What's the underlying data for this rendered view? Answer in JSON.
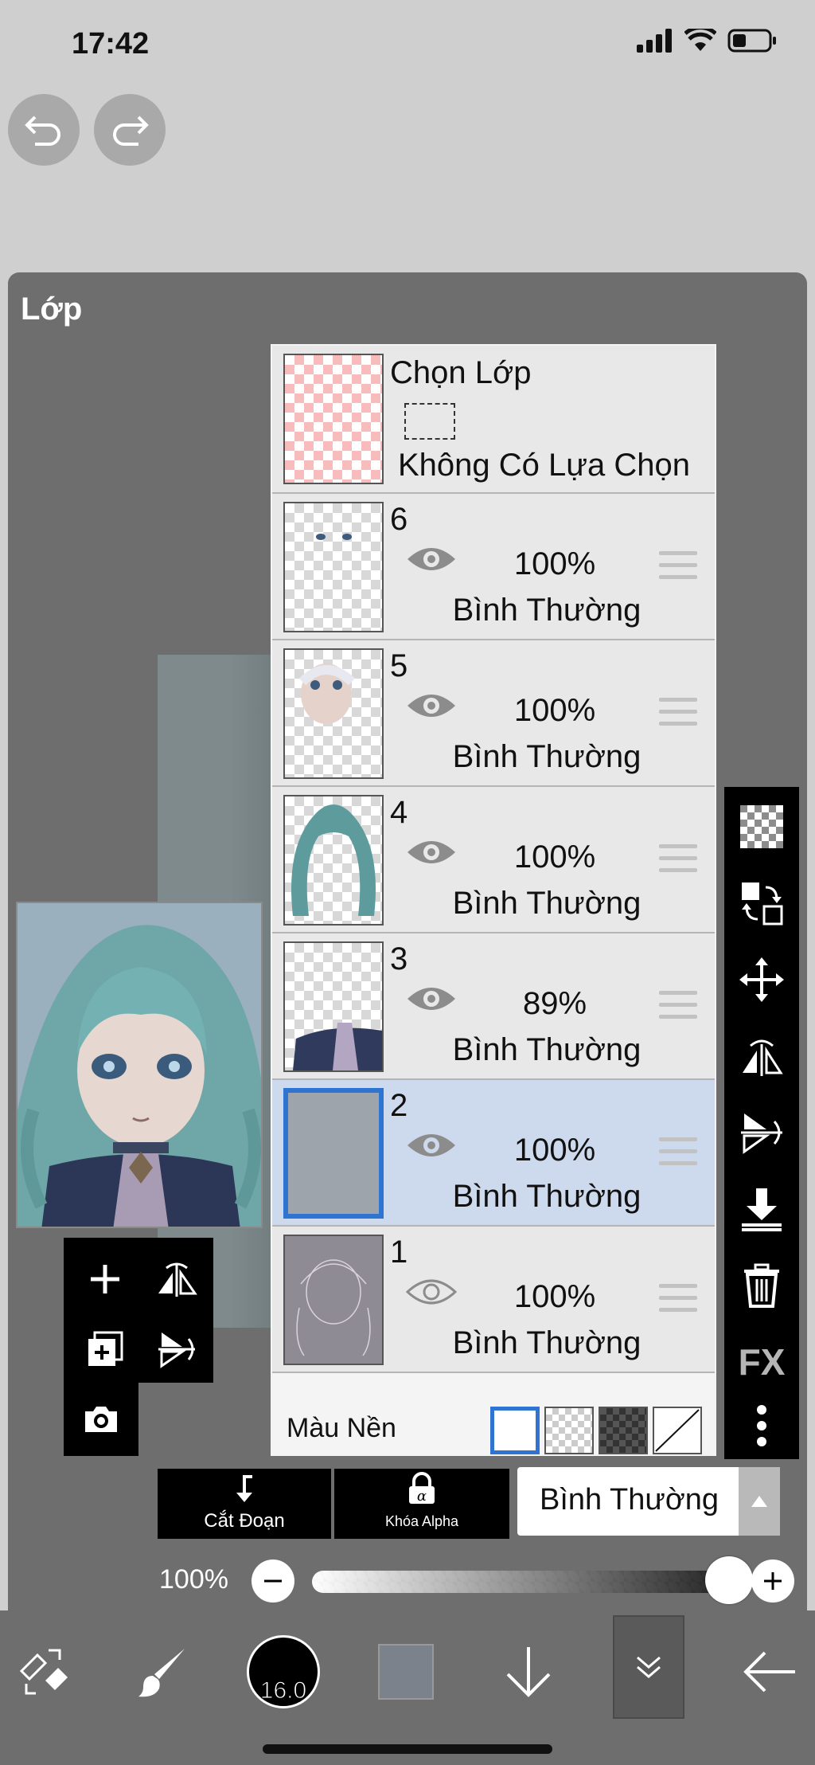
{
  "status": {
    "time": "17:42"
  },
  "panel": {
    "title": "Lớp"
  },
  "selection_layer": {
    "title": "Chọn Lớp",
    "status": "Không Có Lựa Chọn"
  },
  "layers": [
    {
      "number": "6",
      "opacity": "100%",
      "blend": "Bình Thường",
      "visible": true,
      "selected": false
    },
    {
      "number": "5",
      "opacity": "100%",
      "blend": "Bình Thường",
      "visible": true,
      "selected": false
    },
    {
      "number": "4",
      "opacity": "100%",
      "blend": "Bình Thường",
      "visible": true,
      "selected": false
    },
    {
      "number": "3",
      "opacity": "89%",
      "blend": "Bình Thường",
      "visible": true,
      "selected": false
    },
    {
      "number": "2",
      "opacity": "100%",
      "blend": "Bình Thường",
      "visible": true,
      "selected": true
    },
    {
      "number": "1",
      "opacity": "100%",
      "blend": "Bình Thường",
      "visible": false,
      "selected": false
    }
  ],
  "background": {
    "label": "Màu Nền"
  },
  "actions": {
    "clipping": "Cắt Đoạn",
    "alpha_lock": "Khóa Alpha",
    "blend_mode": "Bình Thường"
  },
  "opacity_control": {
    "label": "100%",
    "value": 1.0
  },
  "brush": {
    "size": "16.0"
  },
  "colors": {
    "accent": "#2f74d0",
    "current_color": "#7b828c",
    "selected_row": "#cdd9ec"
  },
  "right_toolbar": {
    "fx_label": "FX"
  }
}
